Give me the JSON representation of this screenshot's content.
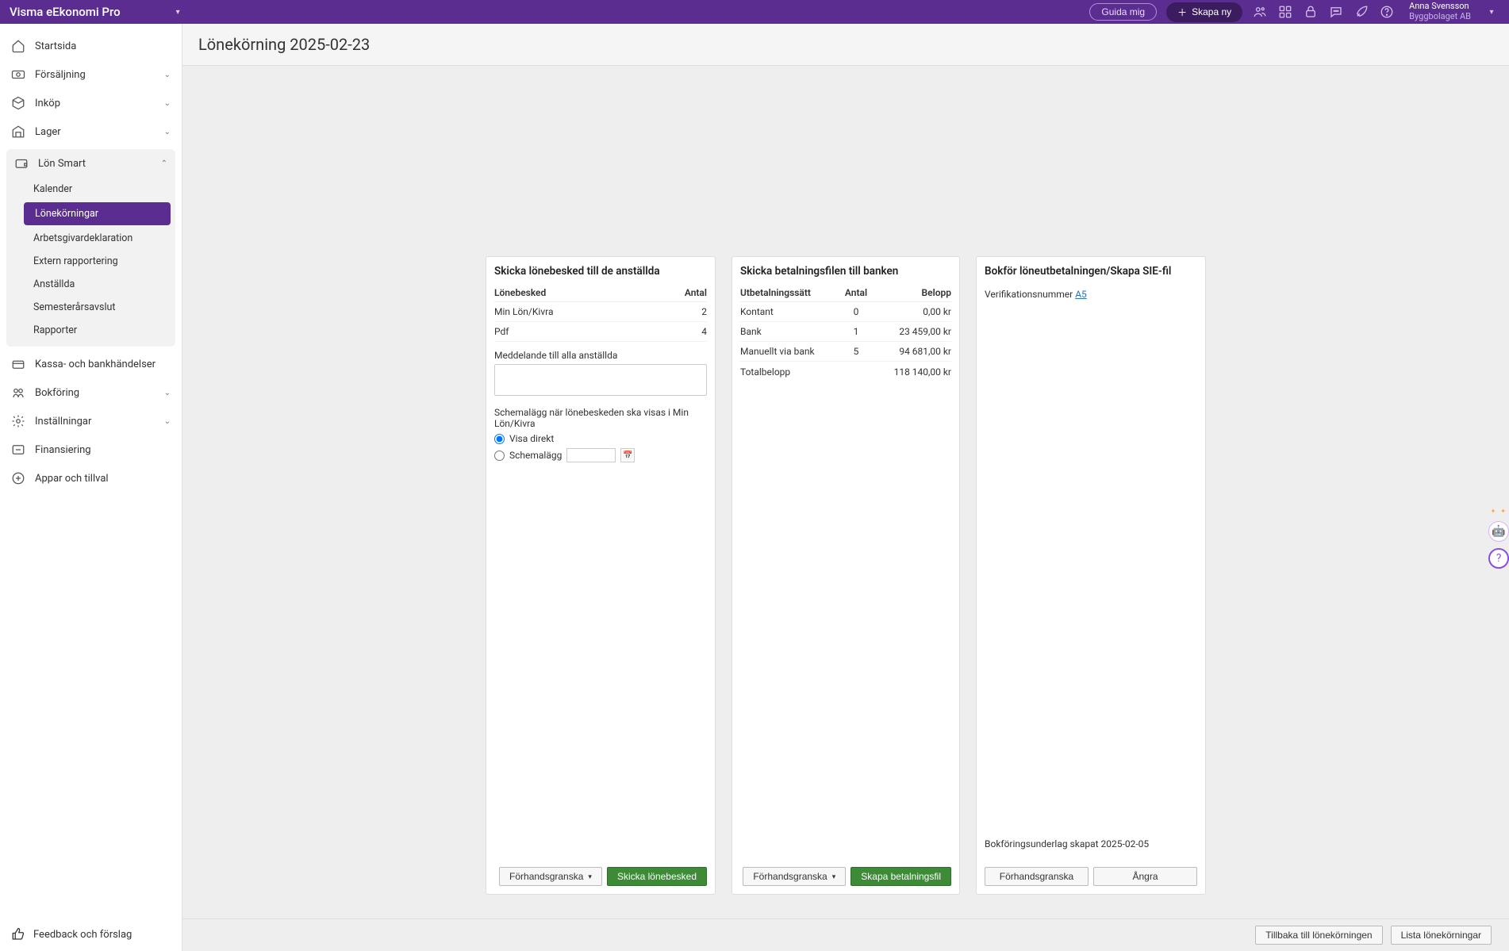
{
  "app": {
    "title": "Visma eEkonomi Pro"
  },
  "topbar": {
    "guide": "Guida mig",
    "create": "Skapa ny",
    "user": {
      "name": "Anna Svensson",
      "company": "Byggbolaget AB"
    }
  },
  "sidebar": {
    "items": {
      "start": "Startsida",
      "sales": "Försäljning",
      "purchase": "Inköp",
      "stock": "Lager",
      "lon": "Lön Smart",
      "kassa": "Kassa- och bankhändelser",
      "bokforing": "Bokföring",
      "installningar": "Inställningar",
      "finansiering": "Finansiering",
      "appar": "Appar och tillval"
    },
    "lon_sub": {
      "kalender": "Kalender",
      "lonekorningar": "Lönekörningar",
      "arbetsgivardekl": "Arbetsgivardeklaration",
      "extern": "Extern rapportering",
      "anstallda": "Anställda",
      "semester": "Semesterårsavslut",
      "rapporter": "Rapporter"
    },
    "feedback": "Feedback och förslag"
  },
  "page": {
    "title": "Lönekörning 2025-02-23"
  },
  "card1": {
    "title": "Skicka lönebesked till de anställda",
    "col_a": "Lönebesked",
    "col_b": "Antal",
    "rows": [
      {
        "name": "Min Lön/Kivra",
        "n": "2"
      },
      {
        "name": "Pdf",
        "n": "4"
      }
    ],
    "msg_label": "Meddelande till alla anställda",
    "sched_label": "Schemalägg när lönebeskeden ska visas i Min Lön/Kivra",
    "opt_now": "Visa direkt",
    "opt_sched": "Schemalägg",
    "preview": "Förhandsgranska",
    "send": "Skicka lönebesked"
  },
  "card2": {
    "title": "Skicka betalningsfilen till banken",
    "col_a": "Utbetalningssätt",
    "col_b": "Antal",
    "col_c": "Belopp",
    "rows": [
      {
        "name": "Kontant",
        "n": "0",
        "amt": "0,00 kr"
      },
      {
        "name": "Bank",
        "n": "1",
        "amt": "23 459,00 kr"
      },
      {
        "name": "Manuellt via bank",
        "n": "5",
        "amt": "94 681,00 kr"
      }
    ],
    "total_label": "Totalbelopp",
    "total_amt": "118 140,00 kr",
    "preview": "Förhandsgranska",
    "create": "Skapa betalningsfil"
  },
  "card3": {
    "title": "Bokför löneutbetalningen/Skapa SIE-fil",
    "ver_label": "Verifikationsnummer",
    "ver_link": "A5",
    "footer_note": "Bokföringsunderlag skapat 2025-02-05",
    "preview": "Förhandsgranska",
    "undo": "Ångra"
  },
  "footer": {
    "back": "Tillbaka till lönekörningen",
    "list": "Lista lönekörningar"
  }
}
